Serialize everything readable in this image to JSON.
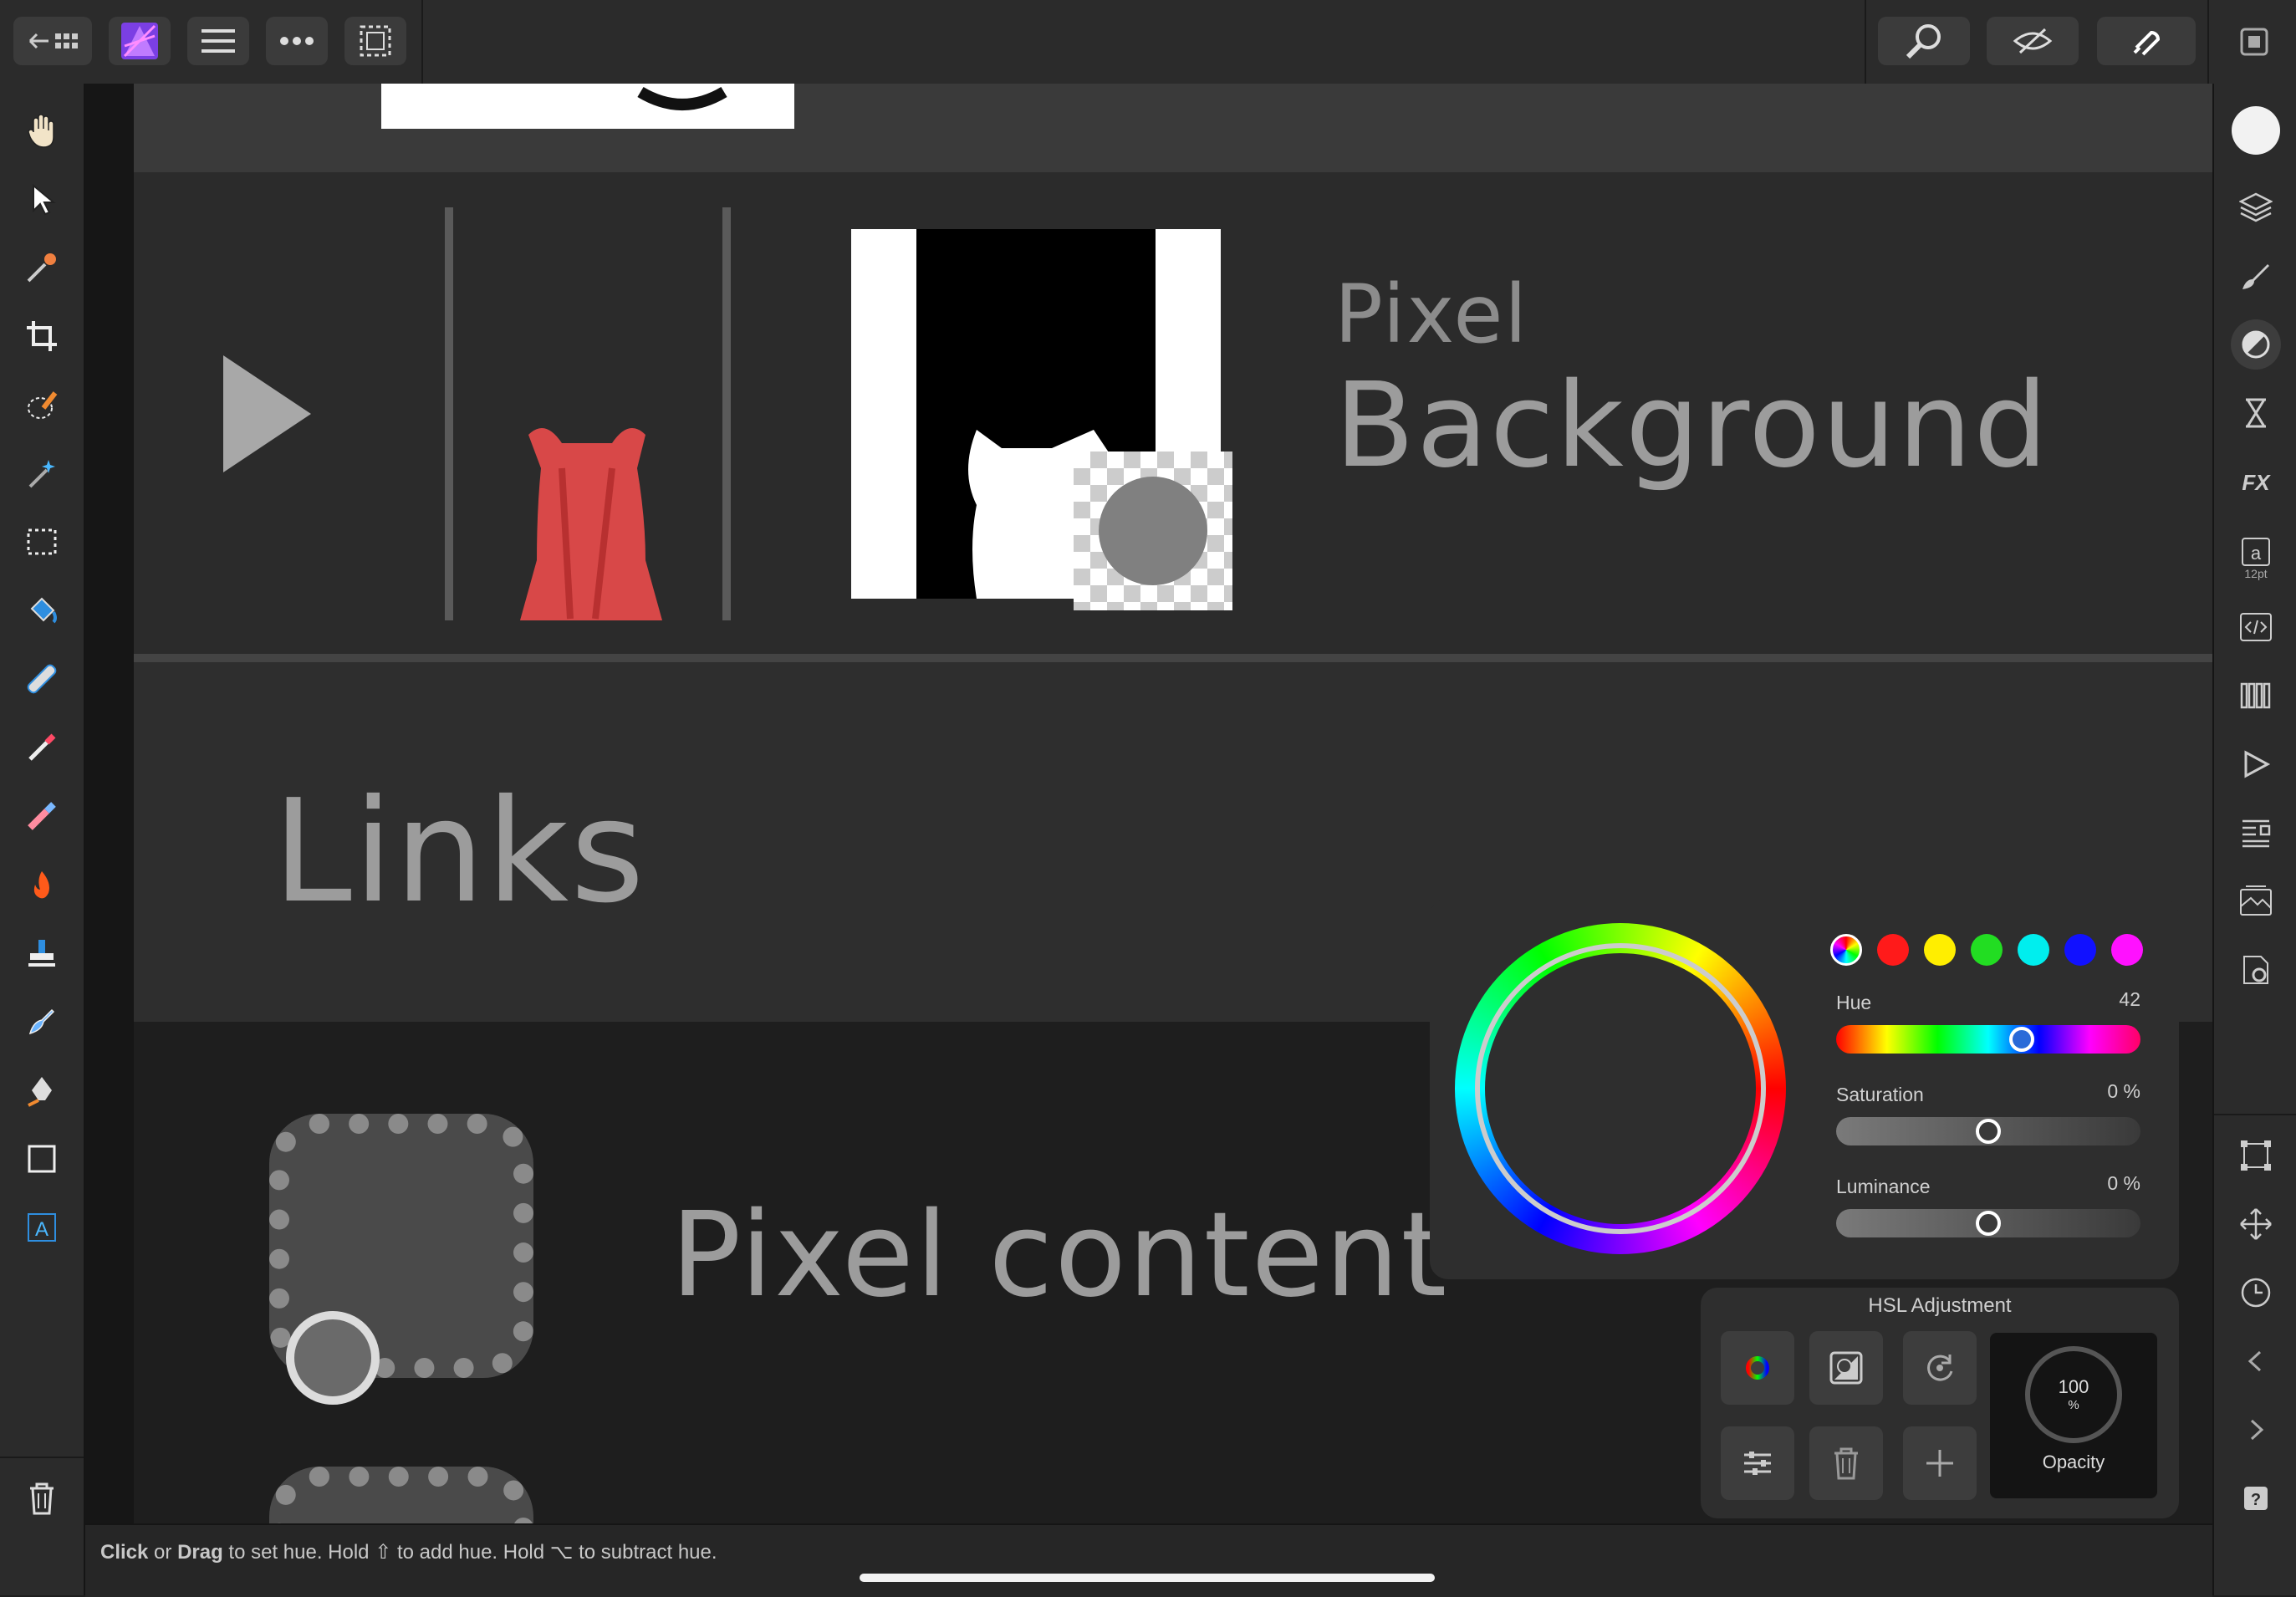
{
  "colors": {
    "accent": "#a060ff",
    "panel": "#2e2e2e",
    "toolbar": "#2b2b2b",
    "canvas": "#1a1a1a"
  },
  "topbar": {
    "back_icon": "back-grid-icon",
    "app_icon": "affinity-photo-icon",
    "menu_icon": "hamburger-icon",
    "more_icon": "more-dots-icon",
    "selection_icon": "selection-marquee-icon",
    "right_icons": [
      "zoom-icon",
      "preview-eye-icon",
      "snapping-magnet-icon",
      "window-icon"
    ]
  },
  "left_tools": [
    "hand-icon",
    "pointer-icon",
    "color-picker-icon",
    "crop-icon",
    "selection-brush-icon",
    "magic-wand-icon",
    "marquee-icon",
    "flood-fill-icon",
    "healing-icon",
    "paint-brush-icon",
    "erase-brush-icon",
    "burn-icon",
    "clone-stamp-icon",
    "smudge-icon",
    "pen-icon",
    "rectangle-icon",
    "text-icon",
    "trash-icon"
  ],
  "right_tools": [
    "color-icon",
    "layers-icon",
    "brushes-icon",
    "adjustments-icon",
    "history-icon",
    "fx-icon",
    "text-style-icon",
    "code-icon",
    "channels-icon",
    "macro-icon",
    "navigator-icon",
    "stock-icon",
    "settings-icon",
    "transform-icon",
    "move-icon",
    "clock-icon",
    "chevron-left-icon",
    "chevron-right-icon",
    "help-icon"
  ],
  "text_style_label": "12pt",
  "canvas": {
    "layer_type": "Pixel",
    "layer_name": "Background",
    "links_label": "Links",
    "pixel_content_label": "Pixel content"
  },
  "color_panel": {
    "hue_label": "Hue",
    "hue_value": "42",
    "hue_fraction": 0.62,
    "saturation_label": "Saturation",
    "saturation_value": "0 %",
    "saturation_fraction": 0.5,
    "luminance_label": "Luminance",
    "luminance_value": "0 %",
    "luminance_fraction": 0.5,
    "swatches": [
      "#ffffff",
      "#ff1a1a",
      "#ffee00",
      "#22dd22",
      "#00eeee",
      "#1111ff",
      "#ff11ff"
    ]
  },
  "hsl_panel": {
    "title": "HSL Adjustment",
    "opacity_value": "100",
    "opacity_unit": "%",
    "opacity_label": "Opacity"
  },
  "status": {
    "bold1": "Click",
    "or": " or ",
    "bold2": "Drag",
    "rest1": " to set hue. Hold ",
    "shift_glyph": "⇧",
    "rest2": " to add hue. Hold ",
    "option_glyph": "⌥",
    "rest3": " to subtract hue."
  }
}
